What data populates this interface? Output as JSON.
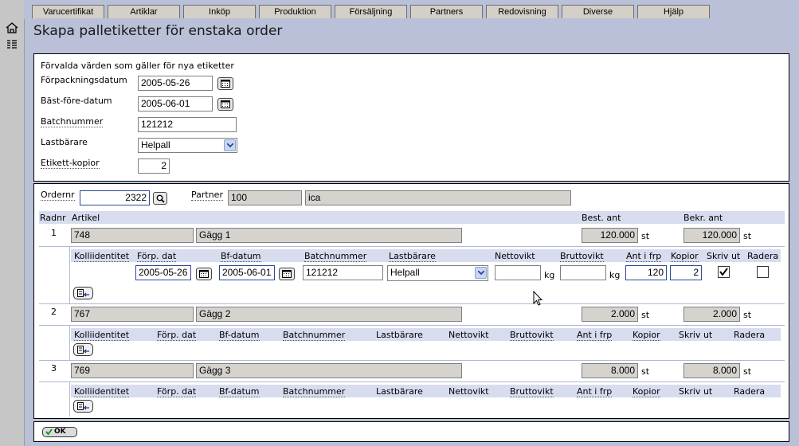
{
  "tabs": [
    "Varucertifikat",
    "Artiklar",
    "Inköp",
    "Produktion",
    "Försäljning",
    "Partners",
    "Redovisning",
    "Diverse",
    "Hjälp"
  ],
  "page_title": "Skapa palletiketter för enstaka order",
  "defaults": {
    "heading": "Förvalda värden som gäller för nya etiketter",
    "forpackningsdatum_label": "Förpackningsdatum",
    "forpackningsdatum": "2005-05-26",
    "bast_fore_label": "Bäst-före-datum",
    "bast_fore": "2005-06-01",
    "batchnummer_label": "Batchnummer",
    "batchnummer": "121212",
    "lastbarare_label": "Lastbärare",
    "lastbarare": "Helpall",
    "kopior_label": "Etikett-kopior",
    "kopior": "2"
  },
  "order": {
    "ordernr_label": "Ordernr",
    "ordernr": "2322",
    "partner_label": "Partner",
    "partner_id": "100",
    "partner_name": "ica"
  },
  "table_headers": {
    "radnr": "Radnr",
    "artikel": "Artikel",
    "best_ant": "Best. ant",
    "bekr_ant": "Bekr. ant"
  },
  "sub_headers": {
    "kolli": "Kolliidentitet",
    "forp_dat": "Förp. dat",
    "bf_datum": "Bf-datum",
    "batchnummer": "Batchnummer",
    "lastbarare": "Lastbärare",
    "nettovikt": "Nettovikt",
    "bruttovikt": "Bruttovikt",
    "ant_i_frp": "Ant i frp",
    "kopior": "Kopior",
    "skriv_ut": "Skriv ut",
    "radera": "Radera"
  },
  "unit_st": "st",
  "unit_kg": "kg",
  "rows": [
    {
      "radnr": "1",
      "artikel_nr": "748",
      "artikel_namn": "Gägg 1",
      "best_ant": "120.000",
      "bekr_ant": "120.000"
    },
    {
      "radnr": "2",
      "artikel_nr": "767",
      "artikel_namn": "Gägg 2",
      "best_ant": "2.000",
      "bekr_ant": "2.000"
    },
    {
      "radnr": "3",
      "artikel_nr": "769",
      "artikel_namn": "Gägg 3",
      "best_ant": "8.000",
      "bekr_ant": "8.000"
    }
  ],
  "label_row": {
    "kolli": "",
    "forp_dat": "2005-05-26",
    "bf_datum": "2005-06-01",
    "batchnummer": "121212",
    "lastbarare": "Helpall",
    "nettovikt": "",
    "bruttovikt": "",
    "ant_i_frp": "120",
    "kopior": "2",
    "skriv_ut": true,
    "radera": false
  },
  "ok_label": "OK"
}
